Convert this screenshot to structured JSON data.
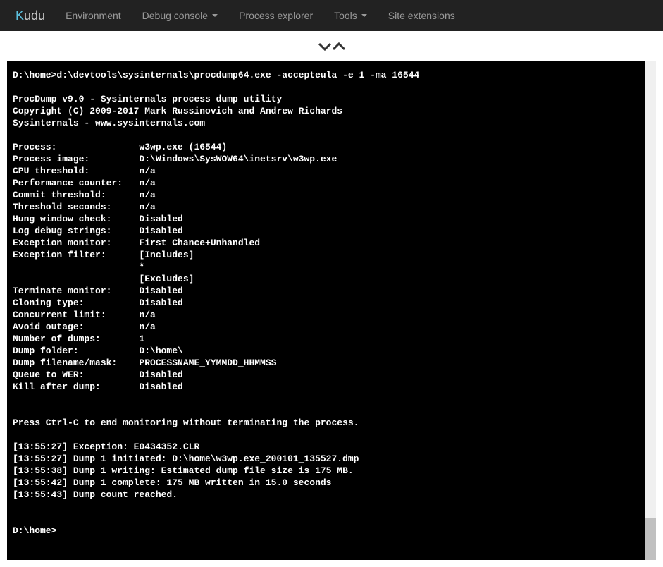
{
  "brand": {
    "k": "K",
    "rest": "udu"
  },
  "nav": {
    "environment": "Environment",
    "debug_console": "Debug console",
    "process_explorer": "Process explorer",
    "tools": "Tools",
    "site_extensions": "Site extensions"
  },
  "console": {
    "output": "D:\\home>d:\\devtools\\sysinternals\\procdump64.exe -accepteula -e 1 -ma 16544\n\nProcDump v9.0 - Sysinternals process dump utility\nCopyright (C) 2009-2017 Mark Russinovich and Andrew Richards\nSysinternals - www.sysinternals.com\n\nProcess:               w3wp.exe (16544)\nProcess image:         D:\\Windows\\SysWOW64\\inetsrv\\w3wp.exe\nCPU threshold:         n/a\nPerformance counter:   n/a\nCommit threshold:      n/a\nThreshold seconds:     n/a\nHung window check:     Disabled\nLog debug strings:     Disabled\nException monitor:     First Chance+Unhandled\nException filter:      [Includes]\n                       *\n                       [Excludes]\nTerminate monitor:     Disabled\nCloning type:          Disabled\nConcurrent limit:      n/a\nAvoid outage:          n/a\nNumber of dumps:       1\nDump folder:           D:\\home\\\nDump filename/mask:    PROCESSNAME_YYMMDD_HHMMSS\nQueue to WER:          Disabled\nKill after dump:       Disabled\n\n\nPress Ctrl-C to end monitoring without terminating the process.\n\n[13:55:27] Exception: E0434352.CLR\n[13:55:27] Dump 1 initiated: D:\\home\\w3wp.exe_200101_135527.dmp\n[13:55:38] Dump 1 writing: Estimated dump file size is 175 MB.\n[13:55:42] Dump 1 complete: 175 MB written in 15.0 seconds\n[13:55:43] Dump count reached.\n\n\nD:\\home>"
  }
}
